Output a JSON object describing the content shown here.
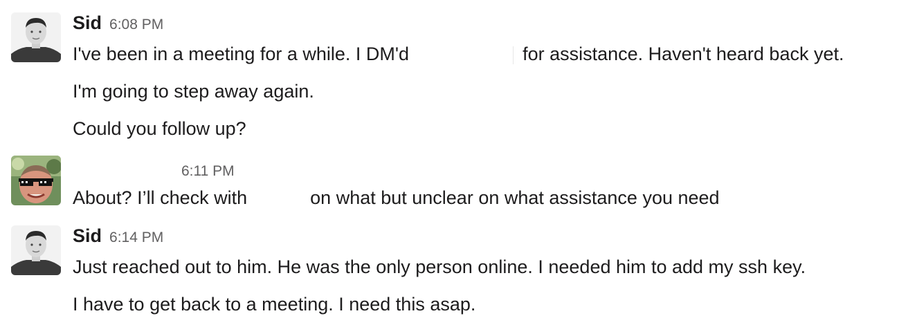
{
  "messages": [
    {
      "author": "Sid",
      "time": "6:08 PM",
      "lines": [
        {
          "before": "I've been in a meeting for a while. I DM'd",
          "after": "for assistance. Haven't heard back yet."
        },
        {
          "text": "I'm going to step away again."
        },
        {
          "text": "Could you follow up?"
        }
      ]
    },
    {
      "author": "",
      "time": "6:11 PM",
      "lines": [
        {
          "before": "About?  I’ll check with",
          "after": "on what but unclear on what assistance you need"
        }
      ]
    },
    {
      "author": "Sid",
      "time": "6:14 PM",
      "lines": [
        {
          "text": "Just reached out to him. He was the only person online. I needed him to add my ssh key."
        },
        {
          "text": "I have to get back to a meeting. I need this asap."
        }
      ]
    }
  ]
}
